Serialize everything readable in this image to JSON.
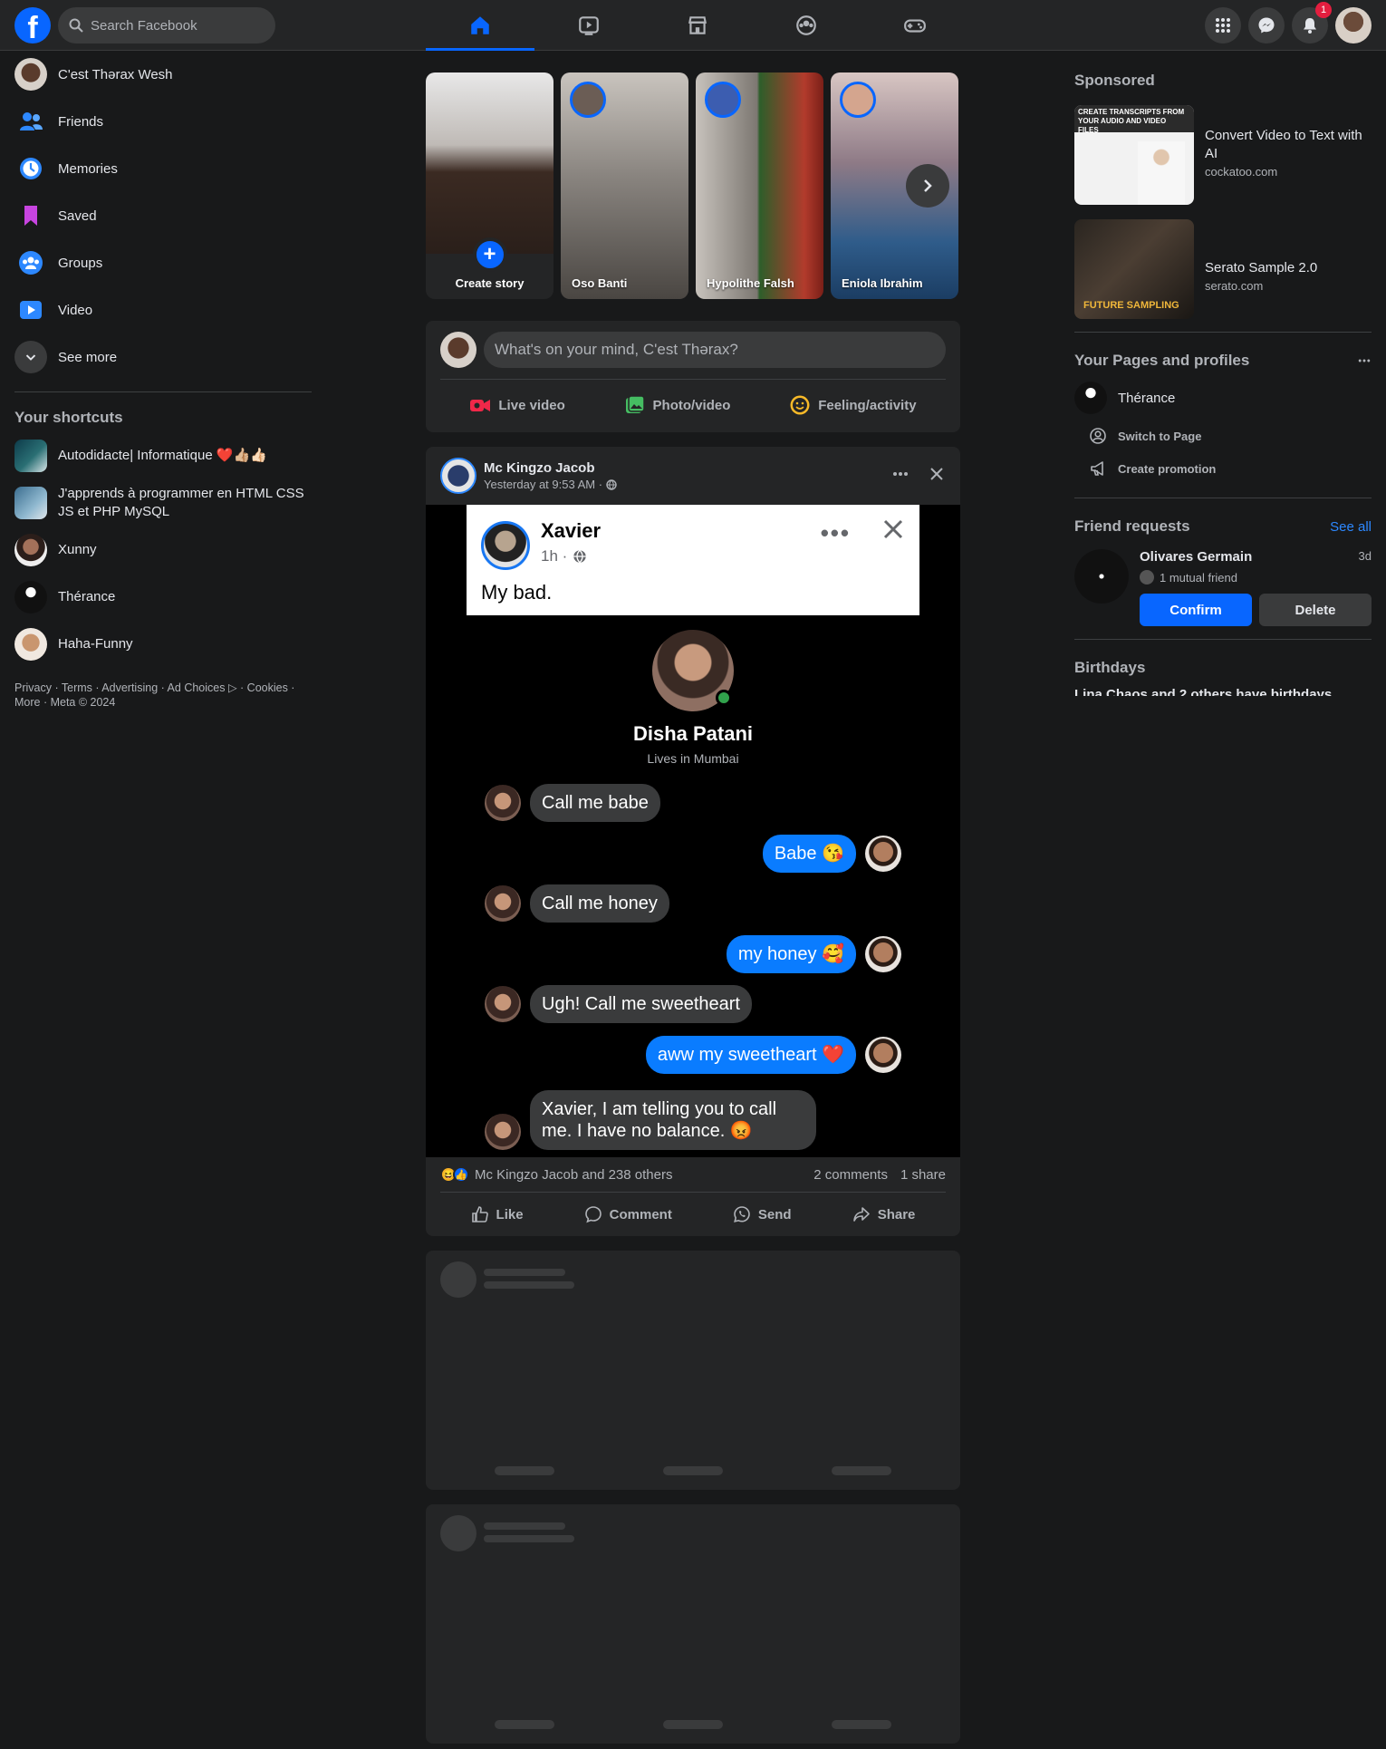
{
  "header": {
    "search_placeholder": "Search Facebook",
    "notifications_count": "1",
    "nav_icons": [
      "home-icon",
      "watch-icon",
      "marketplace-icon",
      "groups-icon",
      "gaming-icon"
    ]
  },
  "sidebar": {
    "profile_name": "C'est Thərax Wesh",
    "items": [
      {
        "label": "Friends",
        "icon": "friends-icon"
      },
      {
        "label": "Memories",
        "icon": "memories-icon"
      },
      {
        "label": "Saved",
        "icon": "saved-icon"
      },
      {
        "label": "Groups",
        "icon": "groups-icon"
      },
      {
        "label": "Video",
        "icon": "video-icon"
      },
      {
        "label": "See more",
        "icon": "chevron-down-icon"
      }
    ],
    "shortcuts_heading": "Your shortcuts",
    "shortcuts": [
      {
        "label": "Autodidacte| Informatique ❤️👍🏼👍🏻"
      },
      {
        "label": "J'apprends à programmer en HTML CSS JS et PHP MySQL"
      },
      {
        "label": "Xunny"
      },
      {
        "label": "Thérance"
      },
      {
        "label": "Haha-Funny"
      }
    ],
    "footer": "Privacy · Terms · Advertising · Ad Choices ▷ · Cookies · More · Meta © 2024"
  },
  "stories": {
    "create_label": "Create story",
    "items": [
      {
        "name": "Oso Banti"
      },
      {
        "name": "Hypolithe Falsh"
      },
      {
        "name": "Eniola Ibrahim"
      }
    ]
  },
  "composer": {
    "placeholder": "What's on your mind, C'est Thərax?",
    "live_label": "Live video",
    "photo_label": "Photo/video",
    "feeling_label": "Feeling/activity"
  },
  "post": {
    "author": "Mc Kingzo Jacob",
    "time": "Yesterday at 9:53 AM ·",
    "inner": {
      "name": "Xavier",
      "time": "1h ·",
      "text": "My bad."
    },
    "chat": {
      "contact_name": "Disha Patani",
      "contact_sub": "Lives in Mumbai",
      "messages": [
        {
          "from": "her",
          "text": "Call me babe"
        },
        {
          "from": "him",
          "text": "Babe 😘"
        },
        {
          "from": "her",
          "text": "Call me honey"
        },
        {
          "from": "him",
          "text": "my honey 🥰"
        },
        {
          "from": "her",
          "text": "Ugh! Call me sweetheart"
        },
        {
          "from": "him",
          "text": "aww my sweetheart ❤️"
        },
        {
          "from": "her",
          "text": "Xavier, I am telling you to call me. I have no balance. 😡"
        }
      ]
    },
    "reactions_text": "Mc Kingzo Jacob and 238 others",
    "comments": "2 comments",
    "shares": "1 share",
    "actions": {
      "like": "Like",
      "comment": "Comment",
      "send": "Send",
      "share": "Share"
    }
  },
  "right": {
    "sponsored_heading": "Sponsored",
    "ads": [
      {
        "title": "Convert Video to Text with AI",
        "domain": "cockatoo.com",
        "image_text": "CREATE TRANSCRIPTS FROM YOUR AUDIO AND VIDEO FILES"
      },
      {
        "title": "Serato Sample 2.0",
        "domain": "serato.com",
        "image_text": "FUTURE SAMPLING"
      }
    ],
    "pages_heading": "Your Pages and profiles",
    "page_name": "Thérance",
    "switch_label": "Switch to Page",
    "promo_label": "Create promotion",
    "fr_heading": "Friend requests",
    "see_all": "See all",
    "fr_name": "Olivares Germain",
    "fr_time": "3d",
    "fr_mutual": "1 mutual friend",
    "confirm": "Confirm",
    "delete": "Delete",
    "birthdays_heading": "Birthdays",
    "birthday_text": "Lina Chaos and 2 others have birthdays"
  }
}
